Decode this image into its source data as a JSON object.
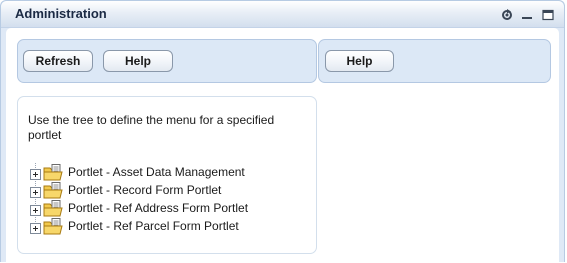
{
  "window": {
    "title": "Administration",
    "controls": [
      "refresh-icon",
      "minimize-icon",
      "maximize-icon"
    ]
  },
  "toolbar_left": {
    "refresh_label": "Refresh",
    "help_label": "Help"
  },
  "toolbar_right": {
    "help_label": "Help"
  },
  "tree": {
    "instruction": "Use the tree to define the menu for a specified portlet",
    "nodes": [
      {
        "label": "Portlet - Asset Data Management",
        "icon": "folder-icon"
      },
      {
        "label": "Portlet - Record Form Portlet",
        "icon": "folder-icon"
      },
      {
        "label": "Portlet - Ref Address Form Portlet",
        "icon": "folder-icon"
      },
      {
        "label": "Portlet - Ref Parcel Form Portlet",
        "icon": "folder-icon"
      }
    ]
  },
  "colors": {
    "panel_bg": "#dce8f6",
    "titlebar_text": "#1b2a44",
    "folder": "#f2c94c"
  }
}
